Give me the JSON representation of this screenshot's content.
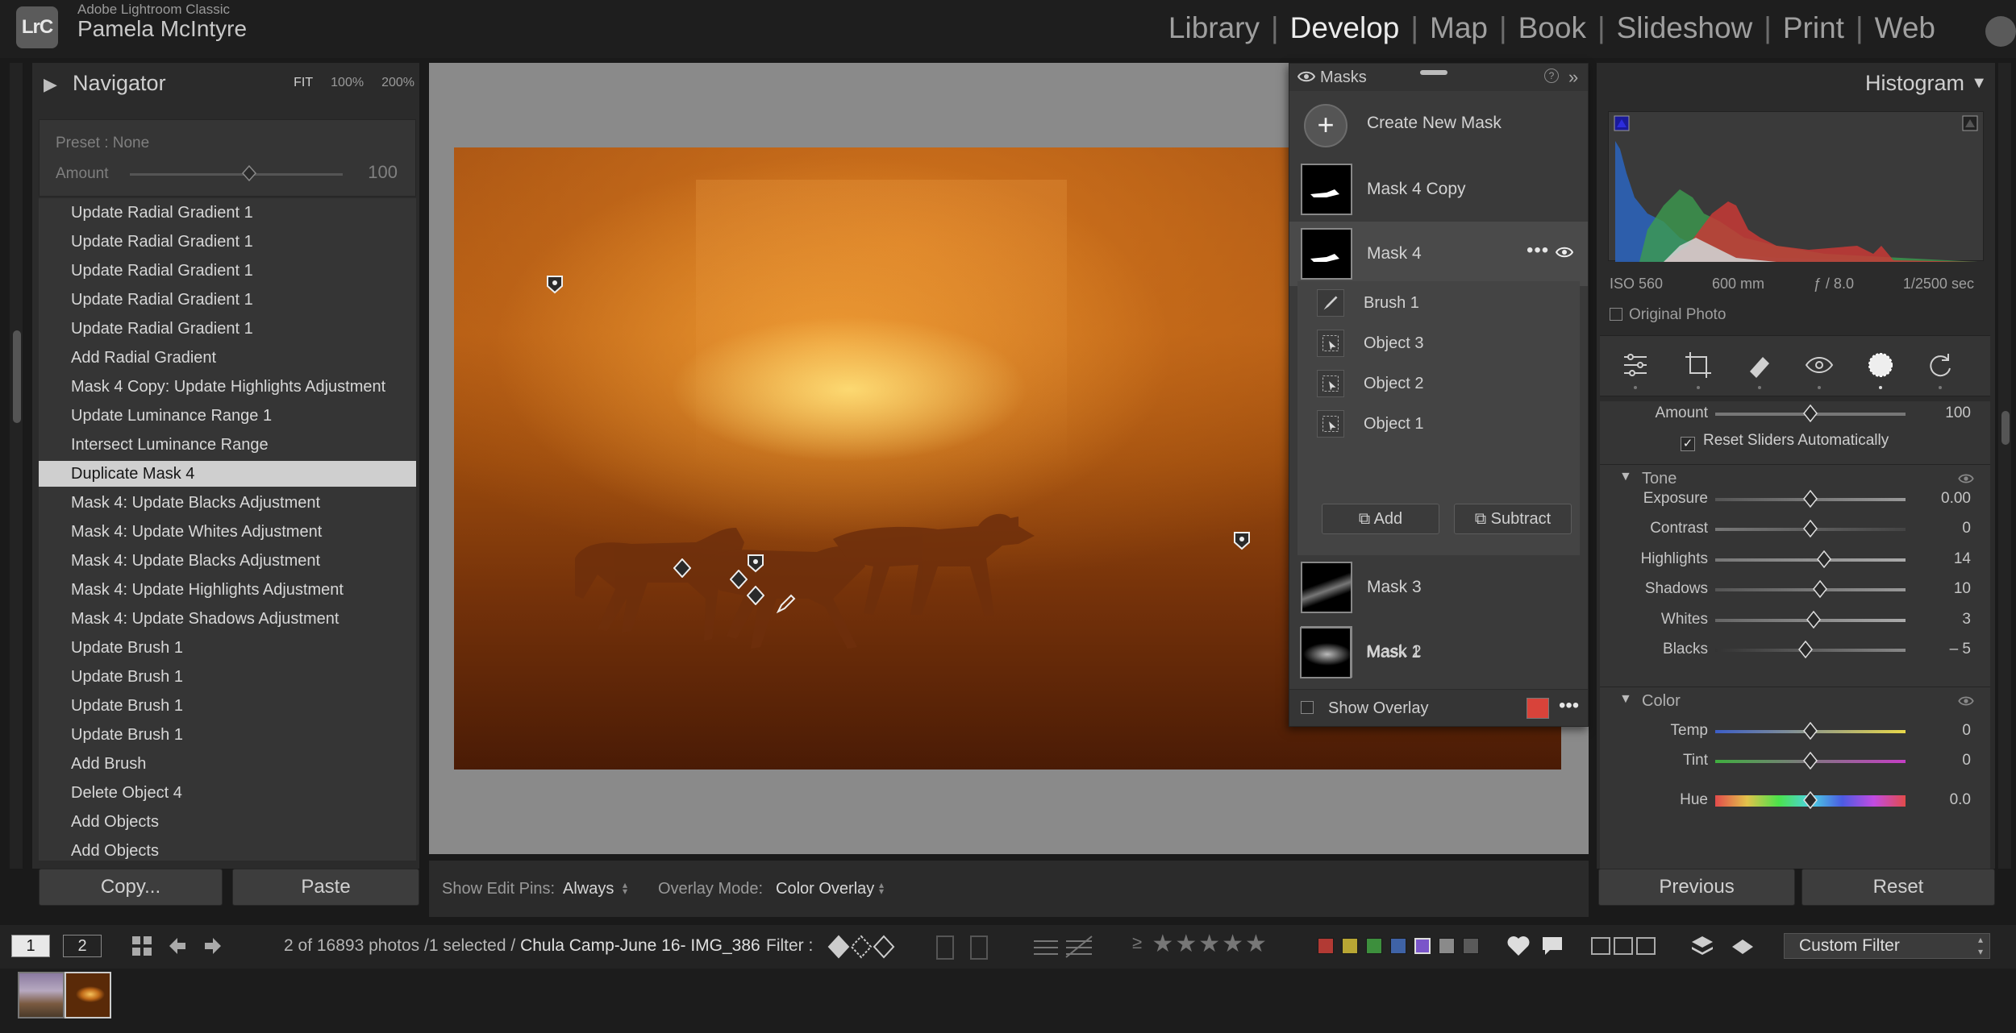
{
  "app": {
    "name": "Adobe Lightroom Classic",
    "user": "Pamela McIntyre",
    "logo": "LrC",
    "modules": [
      "Library",
      "Develop",
      "Map",
      "Book",
      "Slideshow",
      "Print",
      "Web"
    ],
    "active_module": "Develop"
  },
  "navigator": {
    "title": "Navigator",
    "zoom_fit": "FIT",
    "zoom_100": "100%",
    "zoom_200": "200%"
  },
  "preset": {
    "label": "Preset : None",
    "amount_label": "Amount",
    "amount_value": "100",
    "amount_fraction": 0.56
  },
  "history": {
    "items": [
      "Update Radial Gradient 1",
      "Update Radial Gradient 1",
      "Update Radial Gradient 1",
      "Update Radial Gradient 1",
      "Update Radial Gradient 1",
      "Add Radial Gradient",
      "Mask 4 Copy: Update Highlights Adjustment",
      "Update Luminance Range 1",
      "Intersect Luminance Range",
      "Duplicate Mask 4",
      "Mask 4: Update Blacks Adjustment",
      "Mask 4: Update Whites Adjustment",
      "Mask 4: Update Blacks Adjustment",
      "Mask 4: Update Highlights Adjustment",
      "Mask 4: Update Shadows Adjustment",
      "Update Brush 1",
      "Update Brush 1",
      "Update Brush 1",
      "Update Brush 1",
      "Add Brush",
      "Delete Object 4",
      "Add Objects",
      "Add Objects"
    ],
    "selected_index": 9
  },
  "left_buttons": {
    "copy": "Copy...",
    "paste": "Paste"
  },
  "toolbar": {
    "show_pins_label": "Show Edit Pins:",
    "show_pins_value": "Always",
    "overlay_mode_label": "Overlay Mode:",
    "overlay_mode_value": "Color Overlay"
  },
  "masks": {
    "title": "Masks",
    "help": "?",
    "create_label": "Create New Mask",
    "list": [
      {
        "name": "Mask 4 Copy"
      },
      {
        "name": "Mask 4"
      },
      {
        "name": "Mask 3"
      },
      {
        "name": "Mask 2"
      },
      {
        "name": "Mask 1"
      }
    ],
    "selected": "Mask 4",
    "components": [
      "Brush 1",
      "Object 3",
      "Object 2",
      "Object 1"
    ],
    "add_label": "Add",
    "subtract_label": "Subtract",
    "show_overlay_label": "Show Overlay",
    "show_overlay_checked": false,
    "overlay_color": "#d8433a"
  },
  "histogram": {
    "title": "Histogram",
    "iso": "ISO 560",
    "focal": "600 mm",
    "aperture": "ƒ / 8.0",
    "shutter": "1/2500 sec",
    "original_photo_label": "Original Photo"
  },
  "tools": [
    "edit-sliders-icon",
    "crop-icon",
    "healing-icon",
    "red-eye-icon",
    "masking-icon",
    "reset-tool-icon"
  ],
  "adjustments": {
    "amount_label": "Amount",
    "amount_value": "100",
    "amount_fraction": 0.5,
    "reset_sliders_label": "Reset Sliders Automatically",
    "reset_sliders_checked": true,
    "tone_title": "Tone",
    "tone": [
      {
        "label": "Exposure",
        "value": "0.00",
        "pos": 0.5
      },
      {
        "label": "Contrast",
        "value": "0",
        "pos": 0.5
      },
      {
        "label": "Highlights",
        "value": "14",
        "pos": 0.57
      },
      {
        "label": "Shadows",
        "value": "10",
        "pos": 0.55
      },
      {
        "label": "Whites",
        "value": "3",
        "pos": 0.515
      },
      {
        "label": "Blacks",
        "value": "– 5",
        "pos": 0.475
      }
    ],
    "color_title": "Color",
    "color": [
      {
        "label": "Temp",
        "value": "0",
        "pos": 0.5
      },
      {
        "label": "Tint",
        "value": "0",
        "pos": 0.5
      },
      {
        "label": "Hue",
        "value": "0.0",
        "pos": 0.5
      }
    ]
  },
  "right_buttons": {
    "previous": "Previous",
    "reset": "Reset"
  },
  "filmbar": {
    "screen1": "1",
    "screen2": "2",
    "status_prefix": "2 of 16893 photos /1 selected /",
    "filename": "Chula Camp-June  16- IMG_386",
    "filter_label": "Filter :",
    "rating_stars": "★★★★★",
    "rating_op": "≥",
    "color_labels": [
      "#b23a34",
      "#b8a634",
      "#3d8f3d",
      "#3f63a6",
      "#7a55c9",
      "#8a8a8a",
      "#5a5a5a"
    ],
    "custom_filter": "Custom Filter"
  }
}
